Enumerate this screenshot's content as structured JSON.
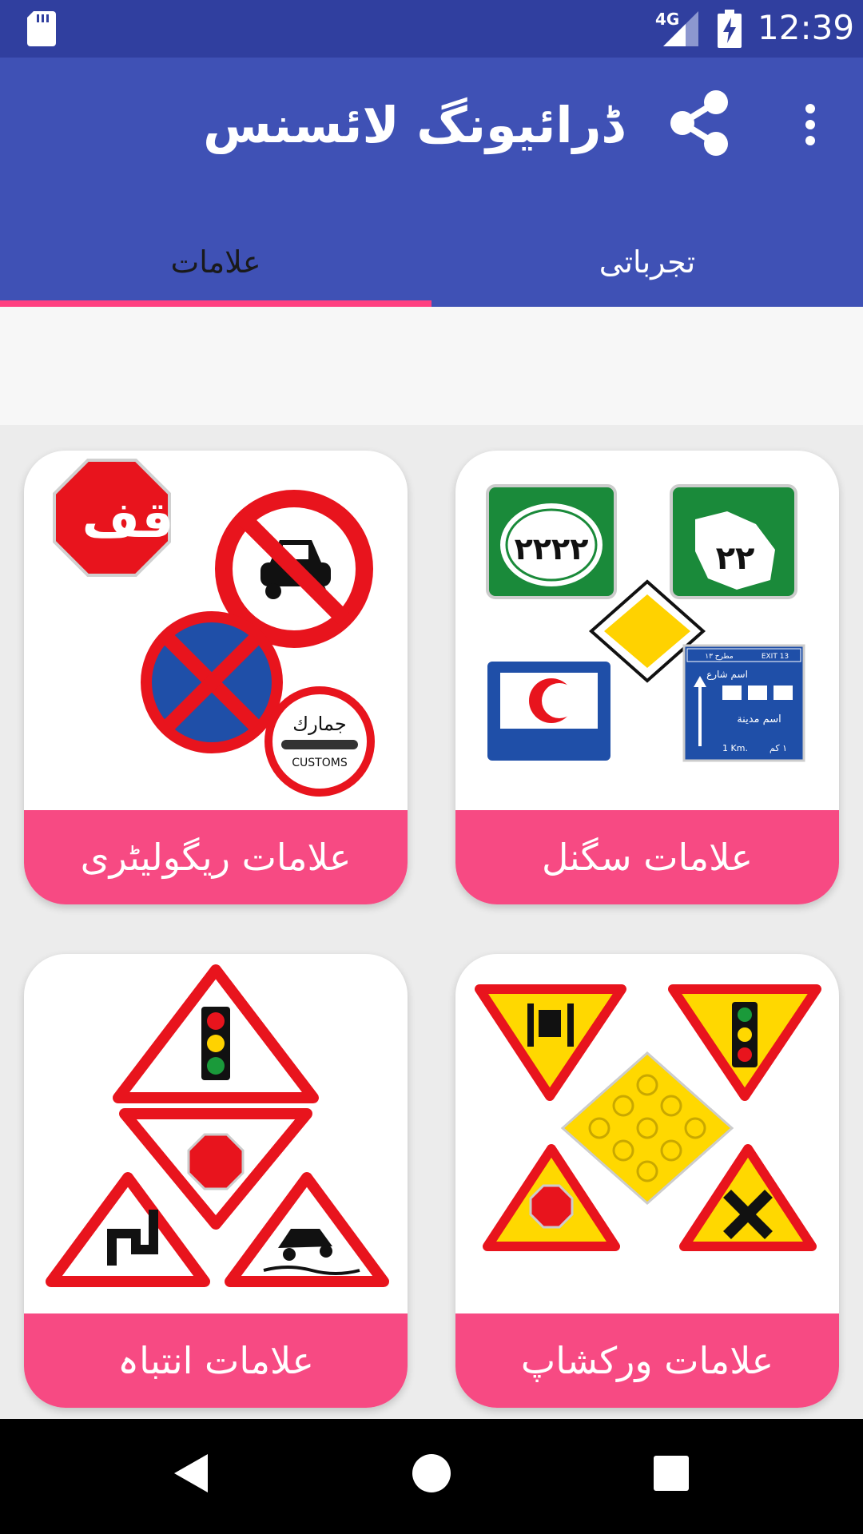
{
  "status_bar": {
    "network": "4G",
    "time": "12:39"
  },
  "app_bar": {
    "title": "ڈرائیونگ لائسنس"
  },
  "tabs": [
    {
      "label": "علامات",
      "selected": true
    },
    {
      "label": "تجرباتی",
      "selected": false
    }
  ],
  "cards": [
    {
      "label": "علامات ریگولیٹری",
      "sign_texts": [
        "قف",
        "جمارك",
        "CUSTOMS"
      ]
    },
    {
      "label": "علامات سگنل",
      "sign_texts": [
        "٢٢٢٢",
        "٢٢",
        "مطرح ١٣",
        "EXIT 13",
        "اسم شارع",
        "اسم مدينة",
        "١ كم",
        "1 Km."
      ]
    },
    {
      "label": "علامات انتباہ"
    },
    {
      "label": "علامات ورکشاپ"
    }
  ],
  "colors": {
    "status_bar": "#303f9f",
    "app_bar": "#3f51b5",
    "tab_indicator": "#ff4081",
    "card_label": "#f74a83"
  }
}
